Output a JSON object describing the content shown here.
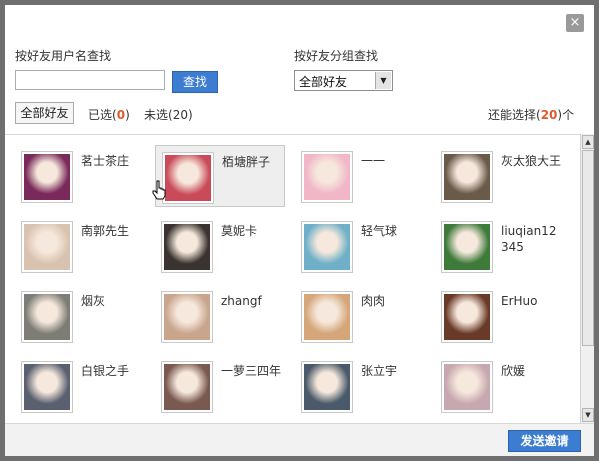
{
  "dialog": {
    "close_symbol": "×",
    "search_by_name_label": "按好友用户名查找",
    "search_input_value": "",
    "search_button": "查找",
    "search_by_group_label": "按好友分组查找",
    "group_select_value": "全部好友",
    "all_friends_tab": "全部好友",
    "selected_label": "已选",
    "selected_count": "0",
    "unselected_label": "未选",
    "unselected_count": "(20)",
    "remaining_prefix": "还能选择(",
    "remaining_count": "20",
    "remaining_suffix": ")个",
    "send_button": "发送邀请"
  },
  "friends": [
    {
      "name": "茗士茶庄",
      "avatar": "tea-logo",
      "color": "#7a2a5a"
    },
    {
      "name": "栢塘胖子",
      "avatar": "baby-photo",
      "color": "#c94b5a"
    },
    {
      "name": "一一",
      "avatar": "pink-girl",
      "color": "#f1b6c8"
    },
    {
      "name": "灰太狼大王",
      "avatar": "boy-photo",
      "color": "#6a5a4a"
    },
    {
      "name": "南郭先生",
      "avatar": "crying-baby",
      "color": "#d9c3b0"
    },
    {
      "name": "莫妮卡",
      "avatar": "smiling-woman",
      "color": "#3a3330"
    },
    {
      "name": "轻气球",
      "avatar": "beach-photo",
      "color": "#6fb0c8"
    },
    {
      "name": "liuqian12345",
      "avatar": "man-glasses",
      "color": "#3e7a3a"
    },
    {
      "name": "烟灰",
      "avatar": "graffiti",
      "color": "#7d7d75"
    },
    {
      "name": "zhangf",
      "avatar": "baby-mustache",
      "color": "#c9a58d"
    },
    {
      "name": "肉肉",
      "avatar": "blonde-woman",
      "color": "#d4a67a"
    },
    {
      "name": "ErHuo",
      "avatar": "monkeys",
      "color": "#6a3a28"
    },
    {
      "name": "白银之手",
      "avatar": "game-character",
      "color": "#5a6070"
    },
    {
      "name": "一萝三四年",
      "avatar": "woman-portrait",
      "color": "#7a5a50"
    },
    {
      "name": "张立宇",
      "avatar": "young-man",
      "color": "#4a5a6a"
    },
    {
      "name": "欣媛",
      "avatar": "little-girl",
      "color": "#c8a8b0"
    }
  ],
  "colors": {
    "accent_blue": "#3d7dd1",
    "count_red": "#e05a2a",
    "hover_bg": "#eeeeee"
  }
}
